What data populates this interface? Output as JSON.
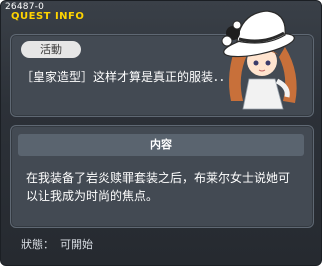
{
  "window": {
    "quest_id": "26487-0",
    "title": "QUEST INFO"
  },
  "quest": {
    "badge": "活動",
    "name": "［皇家造型］这样才算是真正的服装．．",
    "section_header": "内容",
    "description": "在我装备了岩炎赎罪套装之后，布莱尔女士说她可以让我成为时尚的焦点。"
  },
  "status": {
    "label": "狀態：",
    "value": "可開始"
  },
  "colors": {
    "title": "#ffd400",
    "panel": "#434a53",
    "header": "#5a646f"
  },
  "icons": {
    "npc": "npc-portrait-lady-in-white-hat"
  }
}
